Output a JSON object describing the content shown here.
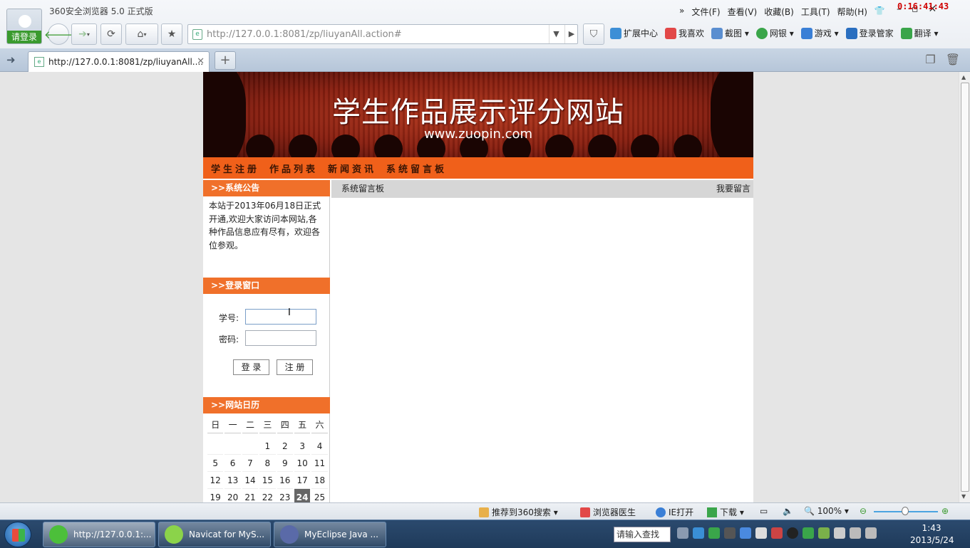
{
  "browser": {
    "login_label": "请登录",
    "app_name": "360安全浏览器 5.0 正式版",
    "menu": [
      "文件(F)",
      "查看(V)",
      "收藏(B)",
      "工具(T)",
      "帮助(H)"
    ],
    "recording_timer": "0:16:41:43",
    "url": "http://127.0.0.1:8081/zp/liuyanAll.action#",
    "toolbar": [
      {
        "label": "扩展中心",
        "icon": "extension-icon",
        "color": "#3d8fd6"
      },
      {
        "label": "我喜欢",
        "icon": "heart-icon",
        "color": "#e24848"
      },
      {
        "label": "截图",
        "icon": "screenshot-icon",
        "color": "#5a8ed0"
      },
      {
        "label": "网银",
        "icon": "bank-icon",
        "color": "#3aa54a"
      },
      {
        "label": "游戏",
        "icon": "game-icon",
        "color": "#3a7fd6"
      },
      {
        "label": "登录管家",
        "icon": "key-icon",
        "color": "#2a6fc0"
      },
      {
        "label": "翻译",
        "icon": "translate-icon",
        "color": "#3aa54a"
      }
    ],
    "tab_title": "http://127.0.0.1:8081/zp/liuyanAll....",
    "status": {
      "recommend": "推荐到360搜索",
      "doctor": "浏览器医生",
      "ie_open": "IE打开",
      "download": "下载",
      "zoom": "100%"
    }
  },
  "site": {
    "banner_title": "学生作品展示评分网站",
    "banner_subtitle": "www.zuopin.com",
    "nav": [
      "学生注册",
      "作品列表",
      "新闻资讯",
      "系统留言板"
    ],
    "notice": {
      "title": ">>系统公告",
      "text": "本站于2013年06月18日正式开通,欢迎大家访问本网站,各种作品信息应有尽有，欢迎各位参观。"
    },
    "login": {
      "title": ">>登录窗口",
      "student_id_label": "学号:",
      "password_label": "密码:",
      "login_button": "登 录",
      "register_button": "注 册"
    },
    "calendar": {
      "title": ">>网站日历",
      "weekdays": [
        "日",
        "一",
        "二",
        "三",
        "四",
        "五",
        "六"
      ],
      "weeks": [
        [
          "",
          "",
          "",
          "1",
          "2",
          "3",
          "4"
        ],
        [
          "5",
          "6",
          "7",
          "8",
          "9",
          "10",
          "11"
        ],
        [
          "12",
          "13",
          "14",
          "15",
          "16",
          "17",
          "18"
        ],
        [
          "19",
          "20",
          "21",
          "22",
          "23",
          "24",
          "25"
        ]
      ],
      "today": "24"
    },
    "main": {
      "title": "系统留言板",
      "action": "我要留言"
    }
  },
  "taskbar": {
    "tasks": [
      {
        "label": "http://127.0.0.1:...",
        "color": "#4cbf3a"
      },
      {
        "label": "Navicat for MyS...",
        "color": "#8bd34a"
      },
      {
        "label": "MyEclipse Java ...",
        "color": "#5a6aa8"
      }
    ],
    "search_placeholder": "请输入查找",
    "time": "1:43",
    "date": "2013/5/24"
  }
}
